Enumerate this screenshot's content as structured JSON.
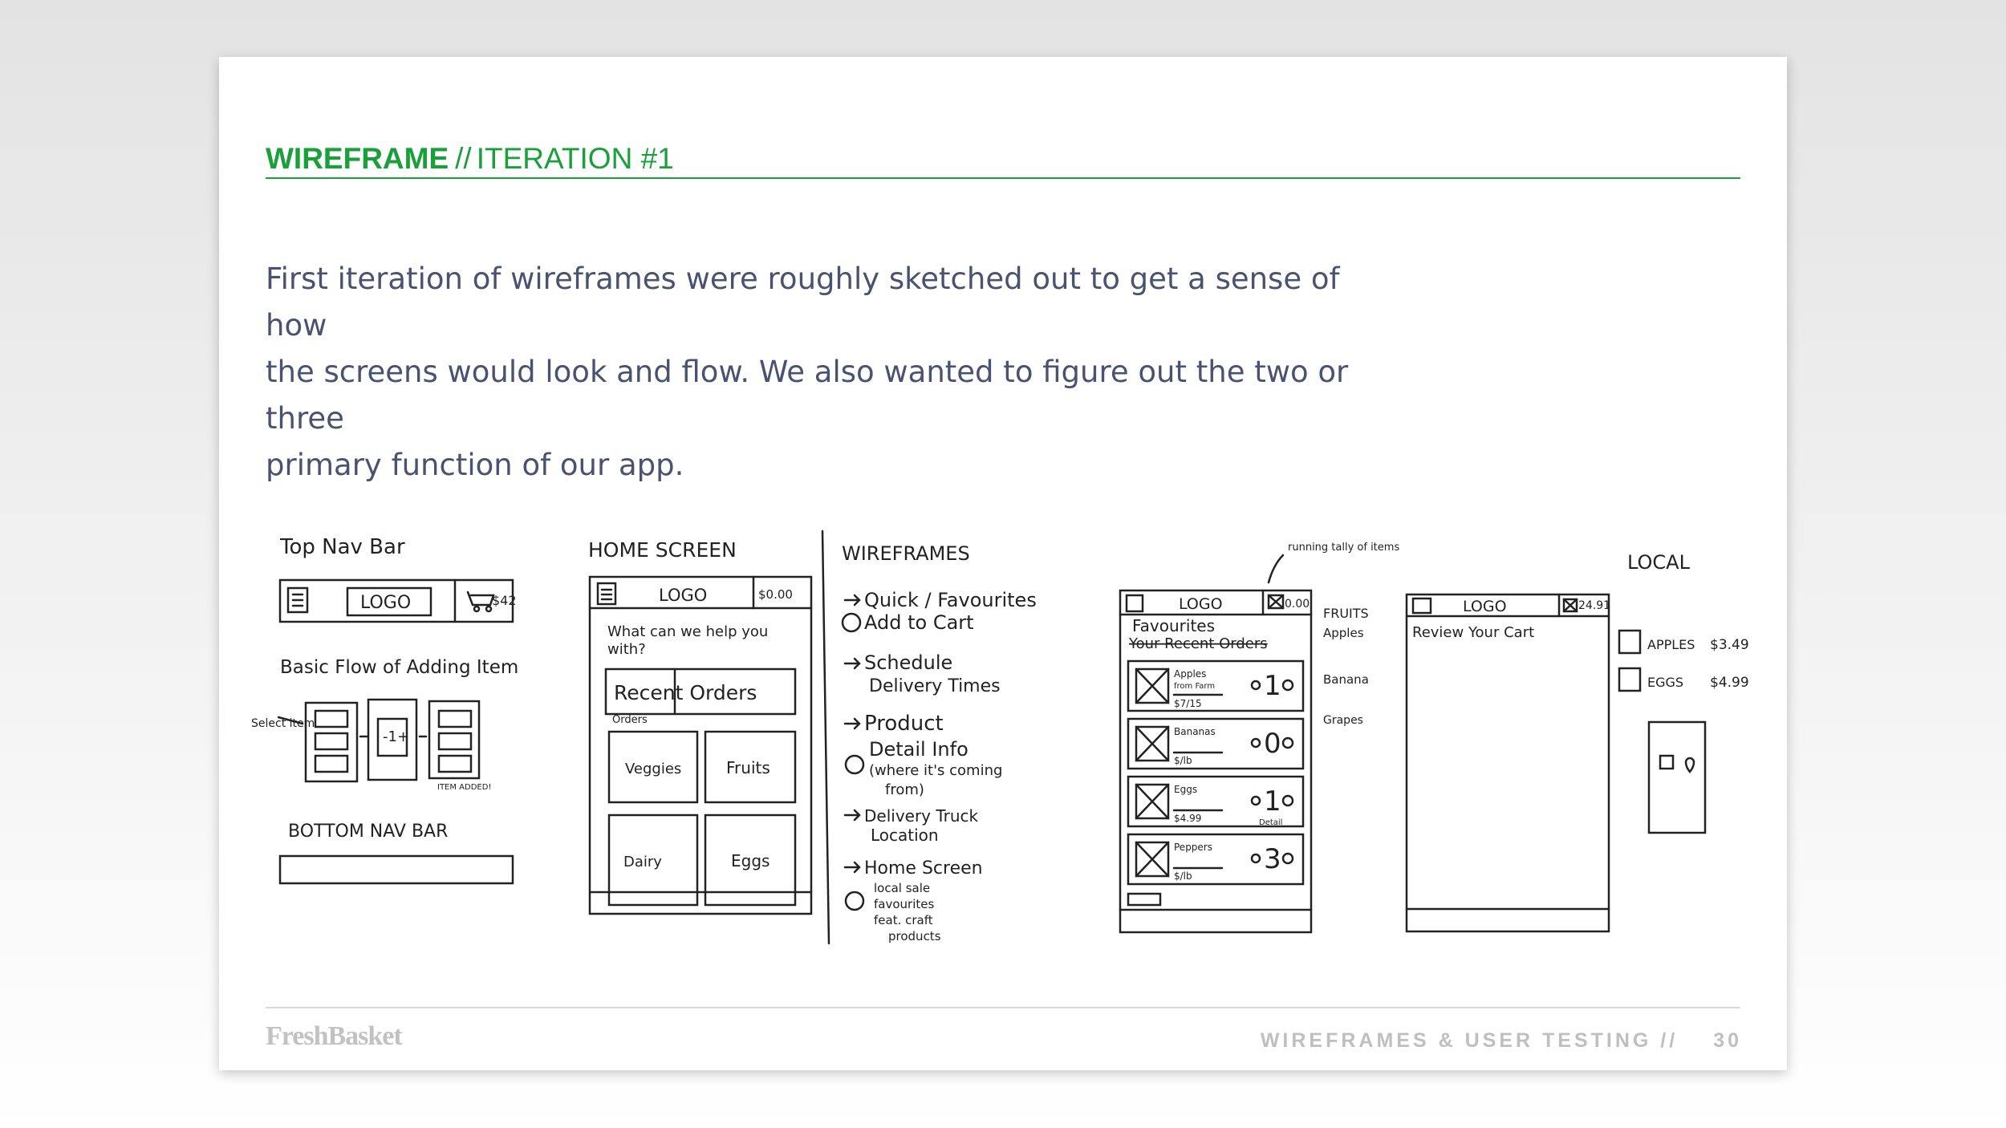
{
  "header": {
    "bold": "WIREFRAME",
    "separator": "//",
    "iteration": "ITERATION #1"
  },
  "intro": {
    "lines": [
      "First iteration of wireframes were roughly sketched out to get a sense of how",
      "the screens would look and flow. We also wanted to figure out the two or three",
      "primary function of our app."
    ]
  },
  "sketch": {
    "s1": {
      "title": "Top Nav Bar",
      "logo": "LOGO",
      "cart": "$42",
      "flow": "Basic Flow of Adding Item",
      "select": "Select item",
      "stepper": "-1+",
      "added": "ITEM ADDED!",
      "bottom": "BOTTOM NAV BAR"
    },
    "s2": {
      "title": "HOME SCREEN",
      "logo": "LOGO",
      "cart": "$0.00",
      "prompt1": "What can we help you",
      "prompt2": "with?",
      "recent": "Recent Orders",
      "orders_small": "Orders",
      "cat1": "Veggies",
      "cat2": "Fruits",
      "cat3": "Dairy",
      "cat4": "Eggs"
    },
    "notes": {
      "title": "WIREFRAMES",
      "items": [
        "Quick / Favourites",
        "Add to Cart",
        "Schedule",
        "Delivery Times",
        "Product",
        "Detail Info",
        "(where it's coming",
        "from)",
        "Delivery Truck",
        "Location",
        "Home Screen",
        "local sale",
        "favourites",
        "feat. craft",
        "products"
      ]
    },
    "s3": {
      "running": "running tally of items",
      "logo": "LOGO",
      "cart": "0.00",
      "fav": "Favourites",
      "recent": "Your Recent Orders",
      "items": [
        {
          "name": "Apples",
          "sub": "from Farm",
          "price": "$7/15",
          "qty": "1"
        },
        {
          "name": "Bananas",
          "sub": "",
          "price": "$/lb",
          "qty": "0"
        },
        {
          "name": "Eggs",
          "sub": "",
          "price": "$4.99",
          "qty": "1"
        },
        {
          "name": "Peppers",
          "sub": "",
          "price": "$/lb",
          "qty": "3"
        }
      ],
      "detail": "Detail",
      "side": [
        "FRUITS",
        "Apples",
        "Banana",
        "Grapes"
      ]
    },
    "s4": {
      "logo": "LOGO",
      "cart": "24.91",
      "review": "Review Your Cart"
    },
    "s5": {
      "title": "LOCAL",
      "item1": "APPLES",
      "price1": "$3.49",
      "item2": "EGGS",
      "price2": "$4.99"
    }
  },
  "footer": {
    "brand": "FreshBasket",
    "section": "WIREFRAMES & USER TESTING //",
    "page": "30"
  }
}
